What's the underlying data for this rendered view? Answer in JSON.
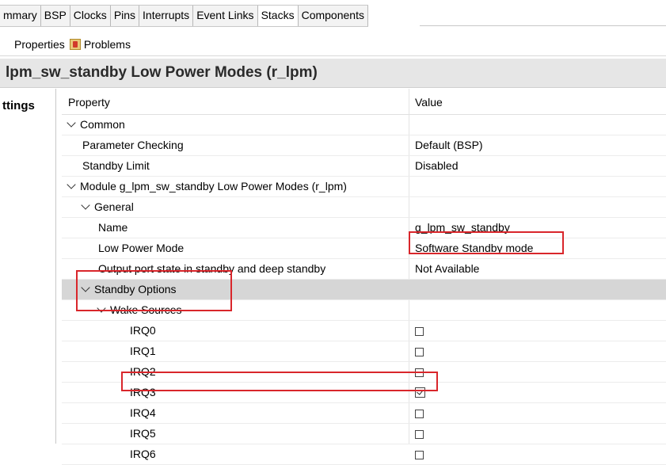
{
  "editor_tabs": [
    "mmary",
    "BSP",
    "Clocks",
    "Pins",
    "Interrupts",
    "Event Links",
    "Stacks",
    "Components"
  ],
  "active_editor_tab": "Stacks",
  "view_tabs": {
    "properties": "Properties",
    "problems": "Problems"
  },
  "title": "lpm_sw_standby Low Power Modes (r_lpm)",
  "side_tab": "ttings",
  "table": {
    "headers": {
      "property": "Property",
      "value": "Value"
    },
    "rows": [
      {
        "label": "Common",
        "value": "",
        "level": 0,
        "expand": true
      },
      {
        "label": "Parameter Checking",
        "value": "Default (BSP)",
        "level": 1
      },
      {
        "label": "Standby Limit",
        "value": "Disabled",
        "level": 1
      },
      {
        "label": "Module g_lpm_sw_standby Low Power Modes (r_lpm)",
        "value": "",
        "level": 0,
        "expand": true
      },
      {
        "label": "General",
        "value": "",
        "level": 1,
        "expand": true
      },
      {
        "label": "Name",
        "value": "g_lpm_sw_standby",
        "level": 2
      },
      {
        "label": "Low Power Mode",
        "value": "Software Standby mode",
        "level": 2
      },
      {
        "label": "Output port state in standby and deep standby",
        "value": "Not Available",
        "level": 2
      },
      {
        "label": "Standby Options",
        "value": "",
        "level": 1,
        "expand": true,
        "selected": true
      },
      {
        "label": "Wake Sources",
        "value": "",
        "level": 2,
        "expand": true
      },
      {
        "label": "IRQ0",
        "checkbox": false,
        "level": 3
      },
      {
        "label": "IRQ1",
        "checkbox": false,
        "level": 3
      },
      {
        "label": "IRQ2",
        "checkbox": false,
        "level": 3
      },
      {
        "label": "IRQ3",
        "checkbox": true,
        "level": 3
      },
      {
        "label": "IRQ4",
        "checkbox": false,
        "level": 3
      },
      {
        "label": "IRQ5",
        "checkbox": false,
        "level": 3
      },
      {
        "label": "IRQ6",
        "checkbox": false,
        "level": 3
      }
    ]
  },
  "colors": {
    "highlight": "#d9262b",
    "selected_row": "#d6d6d6",
    "title_bg": "#e6e6e6"
  }
}
